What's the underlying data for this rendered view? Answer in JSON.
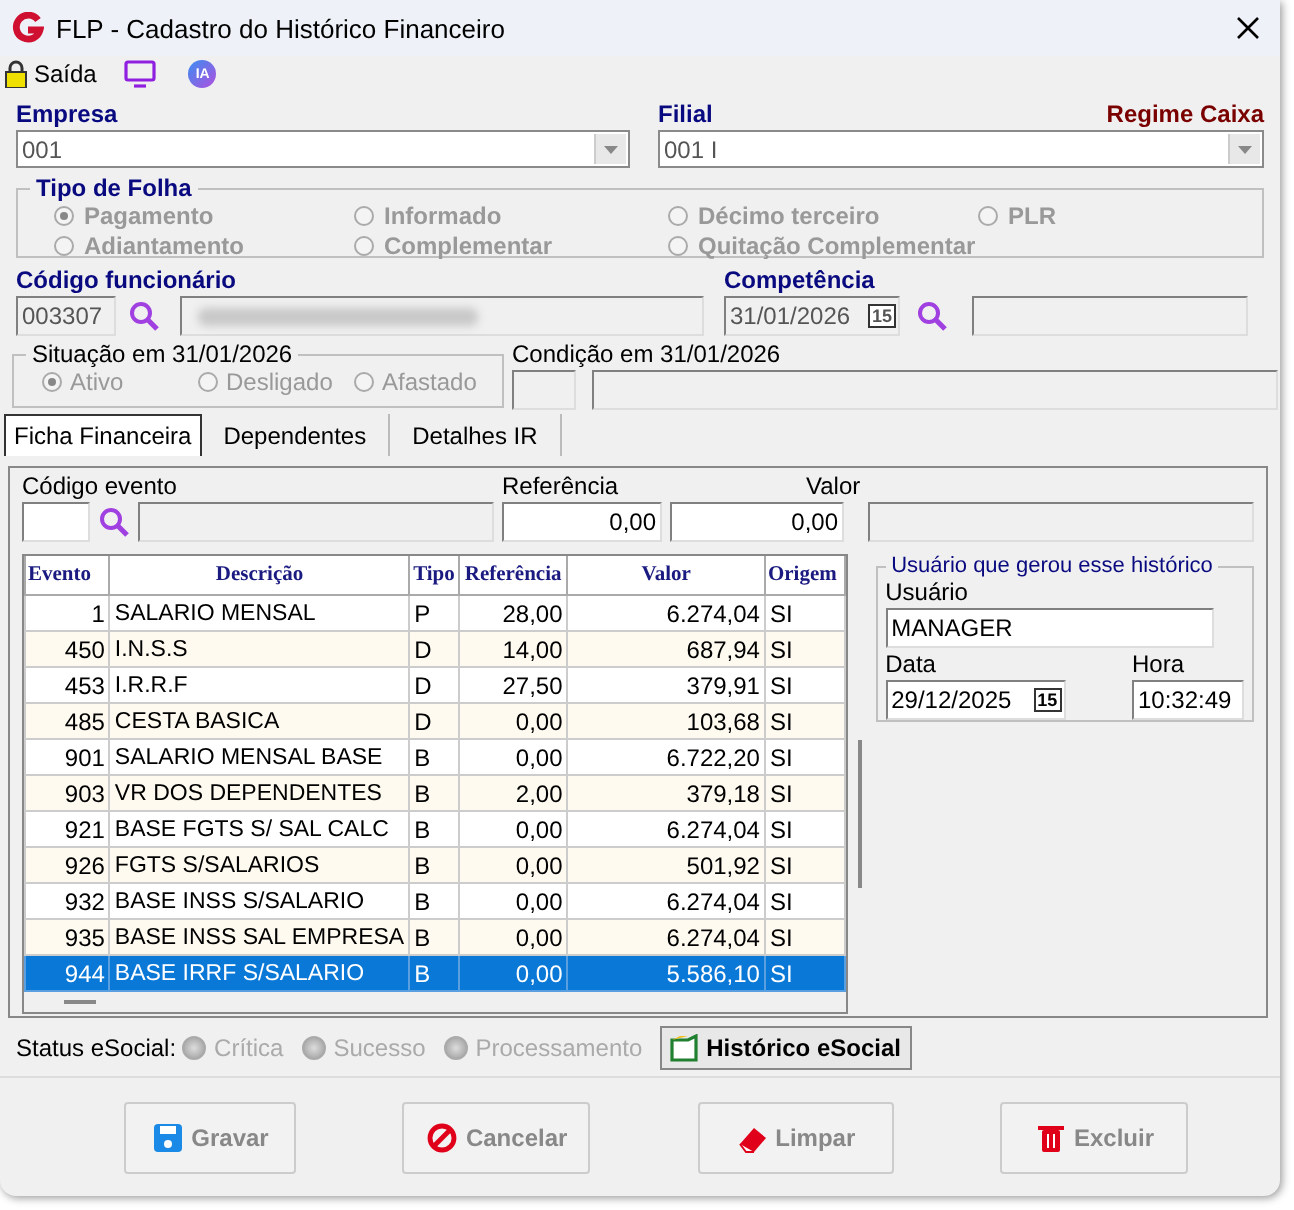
{
  "window": {
    "title": "FLP - Cadastro do Histórico Financeiro"
  },
  "toolbar": [
    {
      "kind": "lock",
      "label": "Saída"
    },
    {
      "kind": "monitor"
    },
    {
      "kind": "ia",
      "label": "IA"
    }
  ],
  "empresa": {
    "label": "Empresa",
    "value": "001"
  },
  "filial": {
    "label": "Filial",
    "value": "001 I",
    "regime": "Regime Caixa"
  },
  "tipo_folha": {
    "title": "Tipo de Folha",
    "options": [
      {
        "label": "Pagamento",
        "selected": true
      },
      {
        "label": "Informado",
        "selected": false
      },
      {
        "label": "Décimo terceiro",
        "selected": false
      },
      {
        "label": "PLR",
        "selected": false
      },
      {
        "label": "Adiantamento",
        "selected": false
      },
      {
        "label": "Complementar",
        "selected": false
      },
      {
        "label": "Quitação Complementar",
        "selected": false
      }
    ]
  },
  "funcionario": {
    "label": "Código funcionário",
    "code": "003307"
  },
  "competencia": {
    "label": "Competência",
    "value": "31/01/2026",
    "calendar_day": "15"
  },
  "situacao": {
    "title": "Situação em  31/01/2026",
    "options": [
      {
        "label": "Ativo",
        "selected": true
      },
      {
        "label": "Desligado",
        "selected": false
      },
      {
        "label": "Afastado",
        "selected": false
      }
    ]
  },
  "condicao": {
    "label": "Condição em 31/01/2026"
  },
  "tabs": [
    {
      "label": "Ficha Financeira",
      "selected": true
    },
    {
      "label": "Dependentes",
      "selected": false
    },
    {
      "label": "Detalhes IR",
      "selected": false
    }
  ],
  "evento": {
    "codigo_label": "Código evento",
    "referencia_label": "Referência",
    "referencia": "0,00",
    "valor_label": "Valor",
    "valor": "0,00"
  },
  "table": {
    "columns": [
      "Evento",
      "Descrição",
      "Tipo",
      "Referência",
      "Valor",
      "Origem"
    ],
    "rows": [
      {
        "cells": [
          "1",
          "SALARIO MENSAL",
          "P",
          "28,00",
          "6.274,04",
          "SI"
        ],
        "selected": false
      },
      {
        "cells": [
          "450",
          "I.N.S.S",
          "D",
          "14,00",
          "687,94",
          "SI"
        ],
        "selected": false
      },
      {
        "cells": [
          "453",
          "I.R.R.F",
          "D",
          "27,50",
          "379,91",
          "SI"
        ],
        "selected": false
      },
      {
        "cells": [
          "485",
          "CESTA BASICA",
          "D",
          "0,00",
          "103,68",
          "SI"
        ],
        "selected": false
      },
      {
        "cells": [
          "901",
          "SALARIO MENSAL BASE",
          "B",
          "0,00",
          "6.722,20",
          "SI"
        ],
        "selected": false
      },
      {
        "cells": [
          "903",
          "VR DOS DEPENDENTES",
          "B",
          "2,00",
          "379,18",
          "SI"
        ],
        "selected": false
      },
      {
        "cells": [
          "921",
          "BASE FGTS S/ SAL CALC",
          "B",
          "0,00",
          "6.274,04",
          "SI"
        ],
        "selected": false
      },
      {
        "cells": [
          "926",
          "FGTS S/SALARIOS",
          "B",
          "0,00",
          "501,92",
          "SI"
        ],
        "selected": false
      },
      {
        "cells": [
          "932",
          "BASE INSS S/SALARIO",
          "B",
          "0,00",
          "6.274,04",
          "SI"
        ],
        "selected": false
      },
      {
        "cells": [
          "935",
          "BASE INSS SAL EMPRESA",
          "B",
          "0,00",
          "6.274,04",
          "SI"
        ],
        "selected": false
      },
      {
        "cells": [
          "944",
          "BASE IRRF S/SALARIO",
          "B",
          "0,00",
          "5.586,10",
          "SI"
        ],
        "selected": true
      }
    ]
  },
  "usuario_box": {
    "title": "Usuário que gerou esse histórico",
    "usuario_label": "Usuário",
    "usuario": "MANAGER",
    "data_label": "Data",
    "data": "29/12/2025",
    "calendar_day": "15",
    "hora_label": "Hora",
    "hora": "10:32:49"
  },
  "status_esocial": {
    "label": "Status eSocial:",
    "options": [
      {
        "label": "Crítica"
      },
      {
        "label": "Sucesso"
      },
      {
        "label": "Processamento"
      }
    ],
    "historico_button": "Histórico eSocial"
  },
  "buttons": [
    {
      "kind": "save",
      "label": "Gravar",
      "disabled": true
    },
    {
      "kind": "cancel",
      "label": "Cancelar",
      "disabled": true
    },
    {
      "kind": "eraser",
      "label": "Limpar",
      "disabled": true
    },
    {
      "kind": "delete",
      "label": "Excluir",
      "disabled": true
    }
  ]
}
